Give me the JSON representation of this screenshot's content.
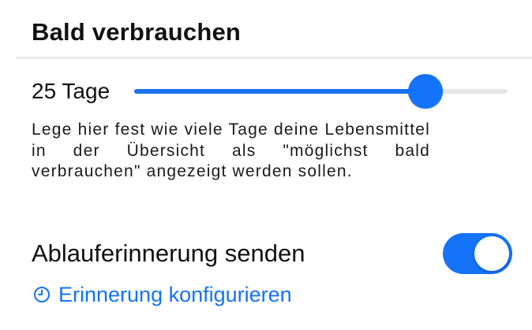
{
  "section": {
    "title": "Bald verbrauchen"
  },
  "slider": {
    "value_label": "25 Tage",
    "level_fraction": 0.78,
    "accent_color": "#1473f6"
  },
  "description": {
    "text": "Lege hier fest wie viele Tage deine Lebensmittel in der Übersicht als \"möglichst bald verbrauchen\" angezeigt werden sollen."
  },
  "reminder": {
    "toggle_label": "Ablauferinnerung senden",
    "toggle_on": true,
    "configure_link": "Erinnerung konfigurieren",
    "link_icon": "clock-icon"
  }
}
